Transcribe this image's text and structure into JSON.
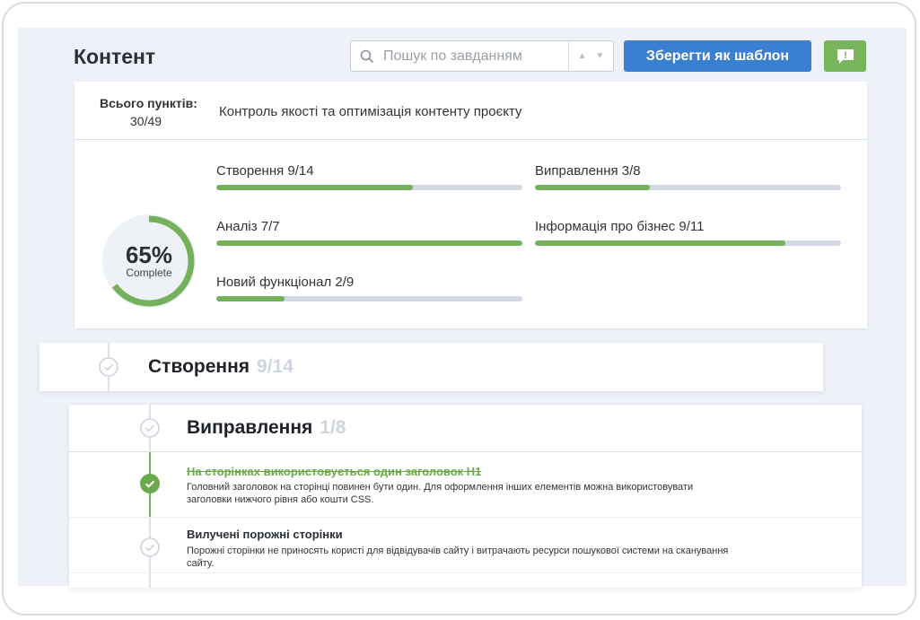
{
  "header": {
    "title": "Контент",
    "search_placeholder": "Пошук по завданням",
    "save_template_label": "Зберегти як шаблон",
    "alert_label": "!"
  },
  "summary": {
    "total_label": "Всього пунктів:",
    "total_value": "30/49",
    "description": "Контроль якості та оптимізація контенту проєкту",
    "percent": "65%",
    "percent_value": 65,
    "complete_label": "Complete",
    "progress": [
      {
        "label": "Створення 9/14",
        "done": 9,
        "total": 14
      },
      {
        "label": "Виправлення 3/8",
        "done": 3,
        "total": 8
      },
      {
        "label": "Аналіз 7/7",
        "done": 7,
        "total": 7
      },
      {
        "label": "Інформація про бізнес 9/11",
        "done": 9,
        "total": 11
      },
      {
        "label": "Новий функціонал 2/9",
        "done": 2,
        "total": 9
      }
    ]
  },
  "sections": [
    {
      "title": "Створення",
      "count": "9/14"
    },
    {
      "title": "Виправлення",
      "count": "1/8"
    }
  ],
  "tasks": [
    {
      "title": "На сторінках використовується один заголовок H1",
      "desc_line1": "Головний заголовок на сторінці повинен бути один. Для оформлення інших елементів можна використовувати",
      "desc_line2": "заголовки нижчого рівня або кошти CSS.",
      "done": true
    },
    {
      "title": "Вилучені порожні сторінки",
      "desc_line1": "Порожні сторінки не приносять користі для відвідувачів сайту і витрачають ресурси пошукової системи на сканування",
      "desc_line2": "сайту.",
      "done": false
    }
  ],
  "colors": {
    "accent_blue": "#3b7fd1",
    "accent_green": "#74b15a",
    "track_gray": "#d3d9e2"
  }
}
